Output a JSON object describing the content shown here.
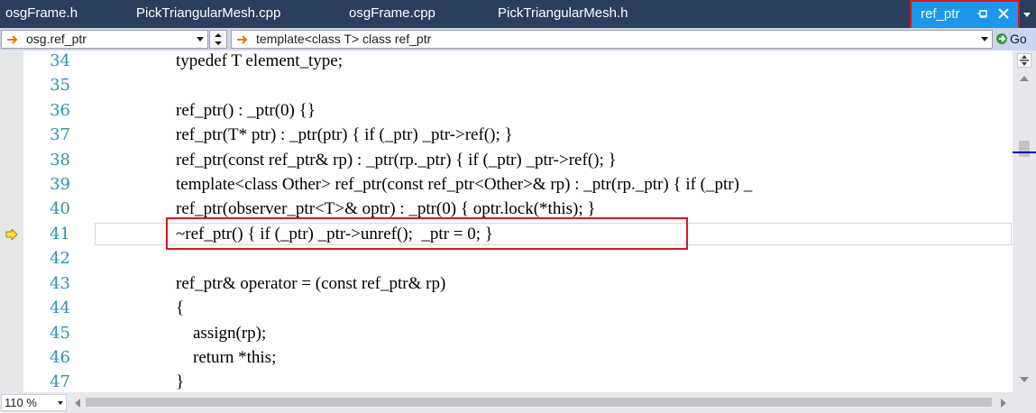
{
  "tabs": [
    {
      "label": "osgFrame.h"
    },
    {
      "label": "PickTriangularMesh.cpp"
    },
    {
      "label": "osgFrame.cpp"
    },
    {
      "label": "PickTriangularMesh.h"
    },
    {
      "label": "ref_ptr",
      "active": true
    }
  ],
  "navigation": {
    "scope": "osg.ref_ptr",
    "member": "template<class T> class ref_ptr",
    "go_label": "Go"
  },
  "editor": {
    "current_line": 41,
    "lines": [
      {
        "number": "34",
        "code": "typedef T element_type;"
      },
      {
        "number": "35",
        "code": ""
      },
      {
        "number": "36",
        "code": "ref_ptr() : _ptr(0) {}"
      },
      {
        "number": "37",
        "code": "ref_ptr(T* ptr) : _ptr(ptr) { if (_ptr) _ptr->ref(); }"
      },
      {
        "number": "38",
        "code": "ref_ptr(const ref_ptr& rp) : _ptr(rp._ptr) { if (_ptr) _ptr->ref(); }"
      },
      {
        "number": "39",
        "code": "template<class Other> ref_ptr(const ref_ptr<Other>& rp) : _ptr(rp._ptr) { if (_ptr) _"
      },
      {
        "number": "40",
        "code": "ref_ptr(observer_ptr<T>& optr) : _ptr(0) { optr.lock(*this); }"
      },
      {
        "number": "41",
        "code": "~ref_ptr() { if (_ptr) _ptr->unref();  _ptr = 0; }"
      },
      {
        "number": "42",
        "code": ""
      },
      {
        "number": "43",
        "code": "ref_ptr& operator = (const ref_ptr& rp)"
      },
      {
        "number": "44",
        "code": "{"
      },
      {
        "number": "45",
        "code": "    assign(rp);"
      },
      {
        "number": "46",
        "code": "    return *this;"
      },
      {
        "number": "47",
        "code": "}"
      }
    ]
  },
  "status": {
    "zoom": "110 %"
  },
  "icons": {
    "nav_scope": "orange-arrow-icon",
    "nav_member": "orange-arrow-icon",
    "go": "go-icon",
    "tab_pin": "pin-icon",
    "tab_close": "close-icon",
    "exec_pointer": "execution-arrow-icon",
    "split": "split-view-icon"
  },
  "colors": {
    "tab_strip": "#2b3e5c",
    "active_tab": "#1c97ea",
    "nav_bar": "#ccd5f0",
    "line_numbers": "#2b91af",
    "highlight_box": "#d71920"
  }
}
